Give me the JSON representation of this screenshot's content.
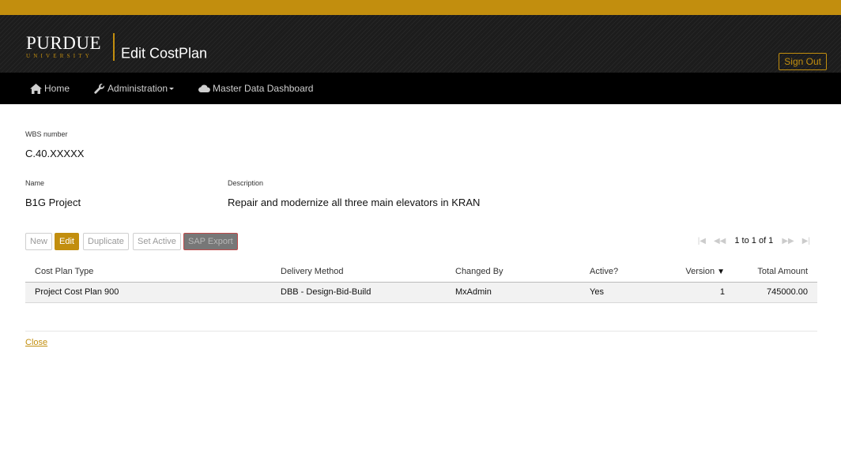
{
  "header": {
    "logo_main": "PURDUE",
    "logo_sub": "UNIVERSITY",
    "title": "Edit CostPlan",
    "sign_out": "Sign Out"
  },
  "nav": {
    "items": [
      {
        "label": "Home",
        "icon": "home-icon"
      },
      {
        "label": "Administration",
        "icon": "wrench-icon"
      },
      {
        "label": "Master Data Dashboard",
        "icon": "cloud-icon"
      }
    ]
  },
  "fields": {
    "wbs_label": "WBS number",
    "wbs_value": "C.40.XXXXX",
    "name_label": "Name",
    "name_value": "B1G Project",
    "desc_label": "Description",
    "desc_value": "Repair and modernize all three main elevators in KRAN"
  },
  "toolbar": {
    "new": "New",
    "edit": "Edit",
    "duplicate": "Duplicate",
    "set_active": "Set Active",
    "sap_export": "SAP Export"
  },
  "pager": {
    "text": "1 to 1 of 1"
  },
  "table": {
    "columns": [
      "Cost Plan Type",
      "Delivery Method",
      "Changed By",
      "Active?",
      "Version",
      "Total Amount"
    ],
    "rows": [
      [
        "Project Cost Plan 900",
        "DBB - Design-Bid-Build",
        "MxAdmin",
        "Yes",
        "1",
        "745000.00"
      ]
    ]
  },
  "footer": {
    "close": "Close"
  },
  "colors": {
    "accent": "#c28e0e",
    "header_bg": "#1c1c1c",
    "nav_bg": "#000000"
  }
}
